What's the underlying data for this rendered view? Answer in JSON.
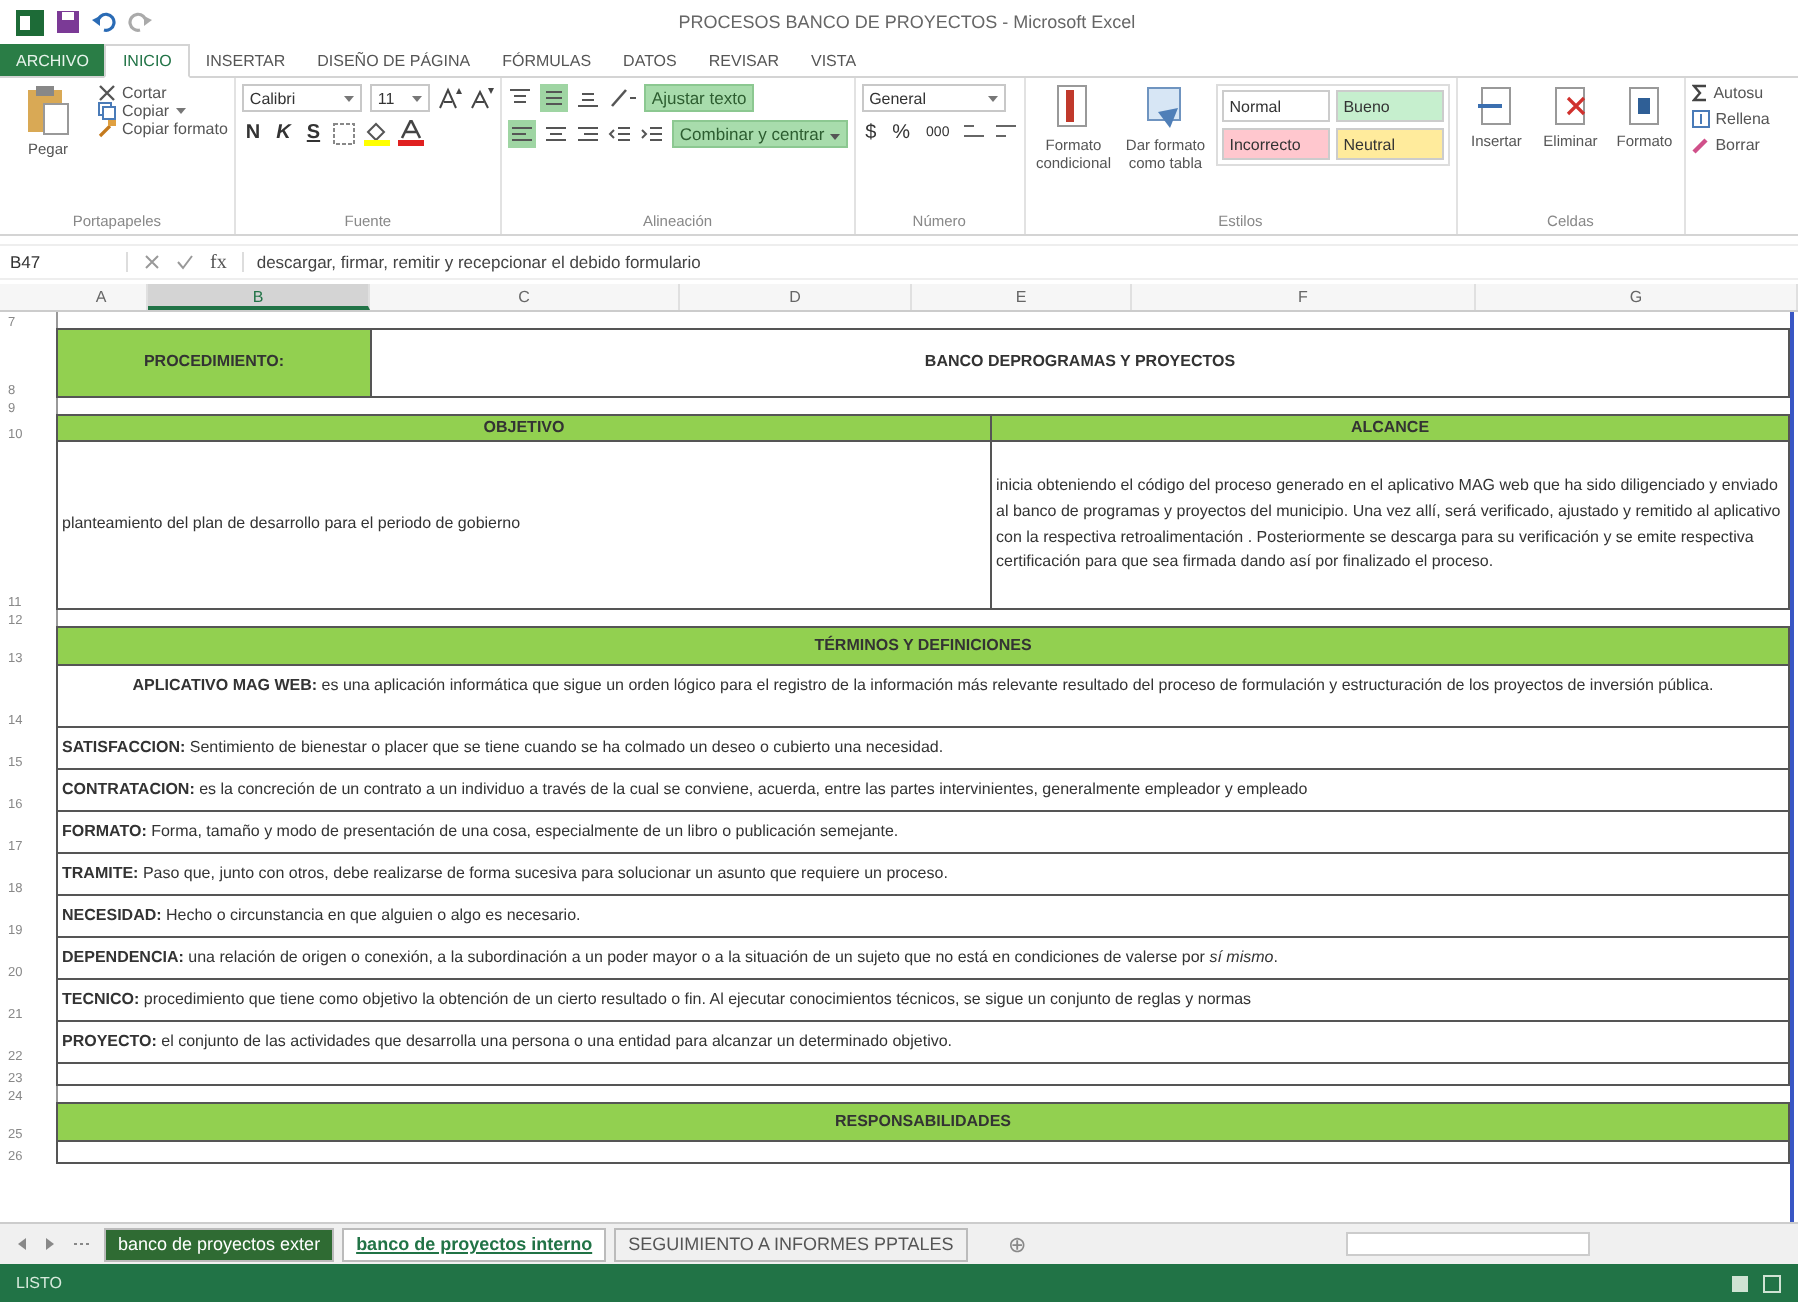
{
  "window": {
    "title": "PROCESOS BANCO DE PROYECTOS - Microsoft Excel"
  },
  "ribbon_tabs": [
    {
      "label": "ARCHIVO",
      "kind": "file",
      "selected": false
    },
    {
      "label": "INICIO",
      "kind": "tab",
      "selected": true
    },
    {
      "label": "INSERTAR",
      "kind": "tab",
      "selected": false
    },
    {
      "label": "DISEÑO DE PÁGINA",
      "kind": "tab",
      "selected": false
    },
    {
      "label": "FÓRMULAS",
      "kind": "tab",
      "selected": false
    },
    {
      "label": "DATOS",
      "kind": "tab",
      "selected": false
    },
    {
      "label": "REVISAR",
      "kind": "tab",
      "selected": false
    },
    {
      "label": "VISTA",
      "kind": "tab",
      "selected": false
    }
  ],
  "clipboard": {
    "paste": "Pegar",
    "cut": "Cortar",
    "copy": "Copiar",
    "format_painter": "Copiar formato",
    "group": "Portapapeles"
  },
  "font": {
    "family": "Calibri",
    "size": "11",
    "bold": "N",
    "italic": "K",
    "underline": "S",
    "group": "Fuente"
  },
  "alignment": {
    "wrap": "Ajustar texto",
    "merge": "Combinar y centrar",
    "group": "Alineación"
  },
  "number": {
    "format": "General",
    "currency": "$",
    "percent": "%",
    "thousands": "000",
    "group": "Número"
  },
  "styles": {
    "conditional": "Formato condicional",
    "as_table": "Dar formato como tabla",
    "group": "Estilos",
    "cell_styles": [
      {
        "label": "Normal",
        "color": "#ffffff"
      },
      {
        "label": "Bueno",
        "color": "#c6efce"
      },
      {
        "label": "Incorrecto",
        "color": "#ffc7ce"
      },
      {
        "label": "Neutral",
        "color": "#ffeb9c"
      }
    ]
  },
  "cells": {
    "insert": "Insertar",
    "delete": "Eliminar",
    "format": "Formato",
    "group": "Celdas"
  },
  "editing": {
    "autosum": "Autosu",
    "fill": "Rellena",
    "clear": "Borrar"
  },
  "formula_bar": {
    "name_box": "B47",
    "function_symbol": "fx",
    "formula": "descargar, firmar, remitir y recepcionar el debido formulario"
  },
  "columns": [
    {
      "label": "A",
      "selected": false
    },
    {
      "label": "B",
      "selected": true
    },
    {
      "label": "C",
      "selected": false
    },
    {
      "label": "D",
      "selected": false
    },
    {
      "label": "E",
      "selected": false
    },
    {
      "label": "F",
      "selected": false
    },
    {
      "label": "G",
      "selected": false
    }
  ],
  "rows": [
    {
      "num": "7",
      "kind": "spacer"
    },
    {
      "num": "8",
      "kind": "label_value",
      "label": "PROCEDIMIENTO:",
      "value": "BANCO DEPROGRAMAS Y PROYECTOS"
    },
    {
      "num": "9",
      "kind": "spacer"
    },
    {
      "num": "10",
      "kind": "heading_pair",
      "left": "OBJETIVO",
      "right": "ALCANCE"
    },
    {
      "num": "11",
      "kind": "text_pair",
      "left": "planteamiento del plan de desarrollo para el periodo de gobierno",
      "right": "inicia obteniendo el código del proceso generado en el aplicativo MAG web que ha sido diligenciado y enviado al banco de programas y proyectos del municipio. Una vez allí, será verificado, ajustado y remitido al aplicativo con la respectiva retroalimentación . Posteriormente se descarga para su verificación y se emite respectiva certificación para que sea firmada dando así por finalizado el proceso."
    },
    {
      "num": "12",
      "kind": "spacer"
    },
    {
      "num": "13",
      "kind": "heading",
      "text": "TÉRMINOS Y DEFINICIONES"
    },
    {
      "num": "14",
      "kind": "term_center",
      "text": "**APLICATIVO MAG WEB:** es una aplicación informática que sigue un orden lógico para el registro de la información más relevante resultado del proceso de formulación y estructuración de los proyectos de inversión pública."
    },
    {
      "num": "15",
      "kind": "term",
      "text": "**SATISFACCION:** Sentimiento de bienestar o placer que se tiene cuando se ha colmado un deseo o cubierto una necesidad."
    },
    {
      "num": "16",
      "kind": "term",
      "text": "**CONTRATACION:** es la concreción de un contrato a un individuo a través de la cual se conviene, acuerda, entre las partes intervinientes, generalmente empleador y empleado"
    },
    {
      "num": "17",
      "kind": "term",
      "text": "**FORMATO:** Forma, tamaño y modo de presentación de una cosa, especialmente de un libro o publicación semejante."
    },
    {
      "num": "18",
      "kind": "term",
      "text": "**TRAMITE:** Paso que, junto con otros, debe realizarse de forma sucesiva para solucionar un asunto que requiere un proceso."
    },
    {
      "num": "19",
      "kind": "term",
      "text": "**NECESIDAD:** Hecho o circunstancia en que alguien o algo es necesario."
    },
    {
      "num": "20",
      "kind": "term",
      "text": "**DEPENDENCIA:**  una relación de origen o conexión, a la subordinación a un poder mayor o a la situación de un sujeto que no está en condiciones de valerse por *sí mismo*."
    },
    {
      "num": "21",
      "kind": "term",
      "text": "**TECNICO:** procedimiento que tiene como objetivo la obtención de un cierto resultado o fin. Al ejecutar conocimientos técnicos, se sigue un conjunto de reglas y normas"
    },
    {
      "num": "22",
      "kind": "term",
      "text": "**PROYECTO:** el conjunto de las actividades que desarrolla una persona o una entidad para alcanzar un determinado objetivo."
    },
    {
      "num": "23",
      "kind": "empty"
    },
    {
      "num": "24",
      "kind": "spacer"
    },
    {
      "num": "25",
      "kind": "heading",
      "text": "RESPONSABILIDADES"
    },
    {
      "num": "26",
      "kind": "empty"
    }
  ],
  "sheet_tabs": [
    {
      "label": "banco de proyectos exter",
      "selected": false,
      "color": "#2f6b33"
    },
    {
      "label": "banco de proyectos interno",
      "selected": true
    },
    {
      "label": "SEGUIMIENTO A INFORMES PPTALES",
      "selected": false
    }
  ],
  "add_sheet": "⊕",
  "status_bar": {
    "text": "LISTO"
  }
}
